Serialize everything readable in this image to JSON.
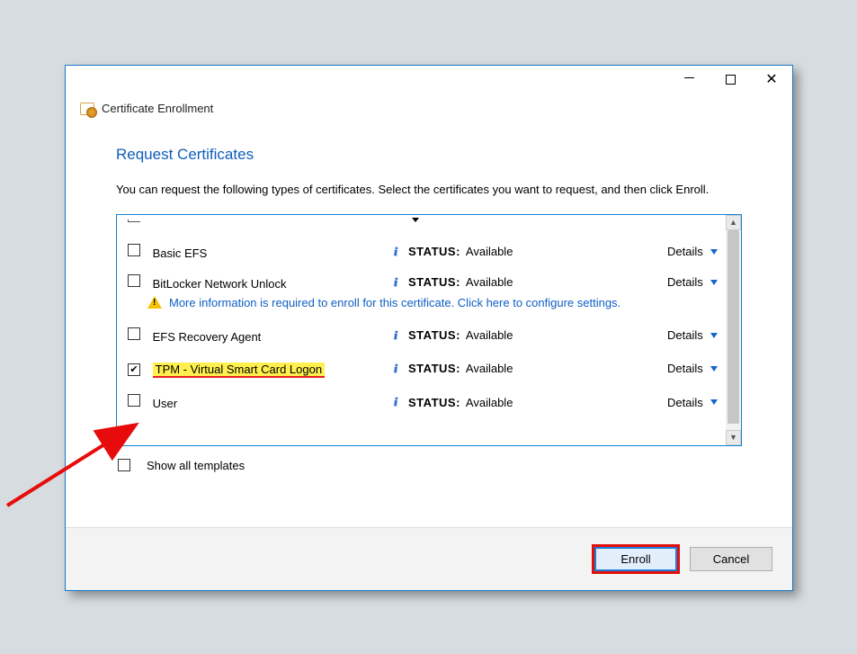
{
  "window": {
    "title": "Certificate Enrollment"
  },
  "section": {
    "heading": "Request Certificates"
  },
  "intro": "You can request the following types of certificates. Select the certificates you want to request, and then click Enroll.",
  "status_word": "STATUS:",
  "details_word": "Details",
  "templates": [
    {
      "name": "Basic EFS",
      "checked": false,
      "status": "Available",
      "highlighted": false
    },
    {
      "name": "BitLocker Network Unlock",
      "checked": false,
      "status": "Available",
      "highlighted": false,
      "warning": "More information is required to enroll for this certificate. Click here to configure settings."
    },
    {
      "name": "EFS Recovery Agent",
      "checked": false,
      "status": "Available",
      "highlighted": false
    },
    {
      "name": "TPM - Virtual Smart Card Logon",
      "checked": true,
      "status": "Available",
      "highlighted": true
    },
    {
      "name": "User",
      "checked": false,
      "status": "Available",
      "highlighted": false
    }
  ],
  "show_all": {
    "label": "Show all templates",
    "checked": false
  },
  "buttons": {
    "enroll": "Enroll",
    "cancel": "Cancel"
  }
}
